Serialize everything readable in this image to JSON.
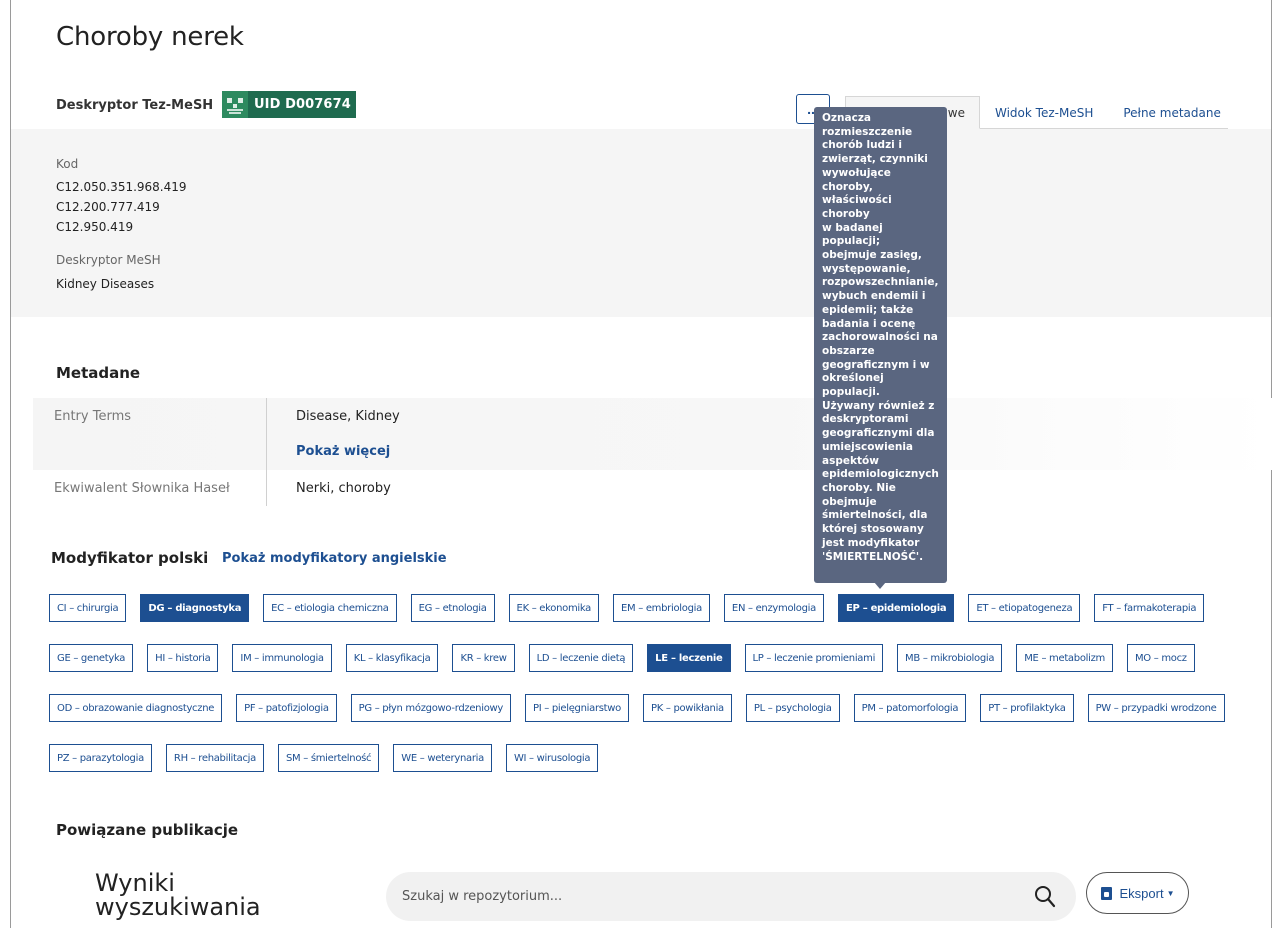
{
  "header": {
    "title": "Choroby nerek",
    "descriptor_type": "Deskryptor Tez-MeSH",
    "uid_label": "UID D007674",
    "more_button": "...",
    "tabs": [
      {
        "label": "Informacje podstawowe",
        "visible_label": "we",
        "active": true
      },
      {
        "label": "Widok Tez-MeSH",
        "active": false
      },
      {
        "label": "Pełne metadane",
        "active": false
      }
    ]
  },
  "summary": {
    "code_label": "Kod",
    "codes": [
      "C12.050.351.968.419",
      "C12.200.777.419",
      "C12.950.419"
    ],
    "mesh_label": "Deskryptor MeSH",
    "mesh_value": "Kidney Diseases"
  },
  "metadata": {
    "title": "Metadane",
    "entry_terms_label": "Entry Terms",
    "entry_terms_value": "Disease, Kidney",
    "show_more": "Pokaż więcej",
    "equivalent_label": "Ekwiwalent Słownika Haseł",
    "equivalent_value": "Nerki, choroby"
  },
  "modifiers": {
    "title": "Modyfikator polski",
    "show_english": "Pokaż modyfikatory angielskie",
    "rows": [
      [
        {
          "label": "CI – chirurgia",
          "selected": false
        },
        {
          "label": "DG – diagnostyka",
          "selected": true
        },
        {
          "label": "EC – etiologia chemiczna",
          "selected": false
        },
        {
          "label": "EG – etnologia",
          "selected": false
        },
        {
          "label": "EK – ekonomika",
          "selected": false
        },
        {
          "label": "EM – embriologia",
          "selected": false
        },
        {
          "label": "EN – enzymologia",
          "selected": false
        },
        {
          "label": "EP – epidemiologia",
          "selected": true
        },
        {
          "label": "ET – etiopatogeneza",
          "selected": false
        },
        {
          "label": "FT – farmakoterapia",
          "selected": false
        }
      ],
      [
        {
          "label": "GE – genetyka",
          "selected": false
        },
        {
          "label": "HI – historia",
          "selected": false
        },
        {
          "label": "IM – immunologia",
          "selected": false
        },
        {
          "label": "KL – klasyfikacja",
          "selected": false
        },
        {
          "label": "KR – krew",
          "selected": false
        },
        {
          "label": "LD – leczenie dietą",
          "selected": false
        },
        {
          "label": "LE – leczenie",
          "selected": true
        },
        {
          "label": "LP – leczenie promieniami",
          "selected": false
        },
        {
          "label": "MB – mikrobiologia",
          "selected": false
        },
        {
          "label": "ME – metabolizm",
          "selected": false
        },
        {
          "label": "MO – mocz",
          "selected": false
        }
      ],
      [
        {
          "label": "OD – obrazowanie diagnostyczne",
          "selected": false
        },
        {
          "label": "PF – patofizjologia",
          "selected": false
        },
        {
          "label": "PG – płyn mózgowo-rdzeniowy",
          "selected": false
        },
        {
          "label": "PI – pielęgniarstwo",
          "selected": false
        },
        {
          "label": "PK – powikłania",
          "selected": false
        },
        {
          "label": "PL – psychologia",
          "selected": false
        },
        {
          "label": "PM – patomorfologia",
          "selected": false
        },
        {
          "label": "PT – profilaktyka",
          "selected": false
        },
        {
          "label": "PW – przypadki wrodzone",
          "selected": false
        }
      ],
      [
        {
          "label": "PZ – parazytologia",
          "selected": false
        },
        {
          "label": "RH – rehabilitacja",
          "selected": false
        },
        {
          "label": "SM – śmiertelność",
          "selected": false
        },
        {
          "label": "WE – weterynaria",
          "selected": false
        },
        {
          "label": "WI – wirusologia",
          "selected": false
        }
      ]
    ]
  },
  "tooltip": {
    "lines": [
      "Oznacza",
      "rozmieszczenie",
      "chorób ludzi i",
      "zwierząt, czynniki",
      "wywołujące",
      "choroby,",
      "właściwości choroby",
      "w badanej populacji;",
      "obejmuje zasięg,",
      "występowanie,",
      "rozpowszechnianie,",
      "wybuch endemii i",
      "epidemii; także",
      "badania i ocenę",
      "zachorowalności na",
      "obszarze",
      "geograficznym i w",
      "określonej populacji.",
      "Używany również z",
      "deskryptorami",
      "geograficznymi dla",
      "umiejscowienia",
      "aspektów",
      "epidemiologicznych",
      "choroby. Nie",
      "obejmuje",
      "śmiertelności, dla",
      "której stosowany",
      "jest modyfikator",
      "'ŚMIERTELNOŚĆ'."
    ]
  },
  "publications": {
    "title": "Powiązane publikacje",
    "results_title_line1": "Wyniki",
    "results_title_line2": "wyszukiwania",
    "search_placeholder": "Szukaj w repozytorium...",
    "search_value": "",
    "export_label": "Eksport"
  },
  "icons": {
    "search": "search-icon",
    "export_doc": "document-icon",
    "caret": "caret-down-icon",
    "mesh_logo": "mesh-logo"
  },
  "colors": {
    "accent": "#1d4f91",
    "uid_badge": "#1f6b4f",
    "tooltip_bg": "#5a6680",
    "panel_bg": "#f5f5f5"
  }
}
